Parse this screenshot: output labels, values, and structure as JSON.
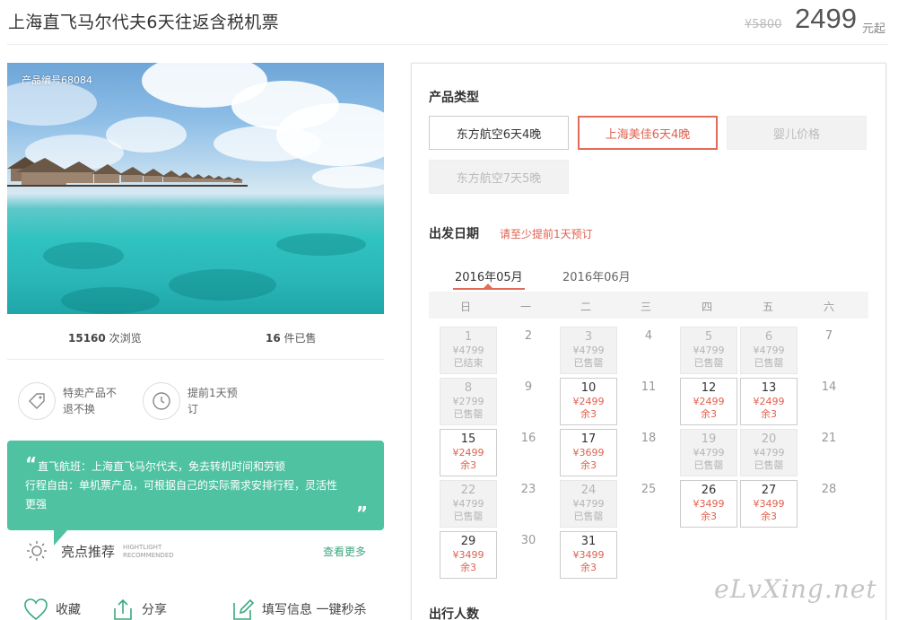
{
  "header": {
    "title": "上海直飞马尔代夫6天往返含税机票",
    "price_old": "¥5800",
    "price_now": "2499",
    "price_unit": "元起"
  },
  "hero": {
    "product_code": "产品编号68084"
  },
  "stats": {
    "views_count": "15160",
    "views_label": "次浏览",
    "sold_count": "16",
    "sold_label": "件已售"
  },
  "features": [
    {
      "icon": "tag-icon",
      "text": "特卖产品不退不换"
    },
    {
      "icon": "clock-icon",
      "text": "提前1天预订"
    }
  ],
  "notice": {
    "open_quote": "“",
    "close_quote": "”",
    "line1": "直飞航班：上海直飞马尔代夫，免去转机时间和劳顿",
    "line2": "行程自由：单机票产品，可根据自己的实际需求安排行程，灵活性",
    "line3": "更强"
  },
  "highlight": {
    "title": "亮点推荐",
    "en1": "HIGHTLIGHT",
    "en2": "RECOMMENDED",
    "more": "查看更多"
  },
  "actions": {
    "favorite": "收藏",
    "share": "分享",
    "fill": "填写信息 一键秒杀"
  },
  "product_type": {
    "title": "产品类型",
    "options": [
      {
        "label": "东方航空6天4晚",
        "state": "normal"
      },
      {
        "label": "上海美佳6天4晚",
        "state": "active"
      },
      {
        "label": "婴儿价格",
        "state": "disabled"
      },
      {
        "label": "东方航空7天5晚",
        "state": "disabled"
      }
    ]
  },
  "departure": {
    "title": "出发日期",
    "hint": "请至少提前1天预订",
    "months": [
      "2016年05月",
      "2016年06月"
    ],
    "weekdays": [
      "日",
      "一",
      "二",
      "三",
      "四",
      "五",
      "六"
    ],
    "days": [
      {
        "d": "1",
        "p": "¥4799",
        "s": "已结束",
        "st": "gray"
      },
      {
        "d": "2",
        "st": "plain"
      },
      {
        "d": "3",
        "p": "¥4799",
        "s": "已售罄",
        "st": "gray"
      },
      {
        "d": "4",
        "st": "plain"
      },
      {
        "d": "5",
        "p": "¥4799",
        "s": "已售罄",
        "st": "gray"
      },
      {
        "d": "6",
        "p": "¥4799",
        "s": "已售罄",
        "st": "gray"
      },
      {
        "d": "7",
        "st": "plain"
      },
      {
        "d": "8",
        "p": "¥2799",
        "s": "已售罄",
        "st": "gray"
      },
      {
        "d": "9",
        "st": "plain"
      },
      {
        "d": "10",
        "p": "¥2499",
        "s": "余3",
        "st": "avail"
      },
      {
        "d": "11",
        "st": "plain"
      },
      {
        "d": "12",
        "p": "¥2499",
        "s": "余3",
        "st": "avail"
      },
      {
        "d": "13",
        "p": "¥2499",
        "s": "余3",
        "st": "avail"
      },
      {
        "d": "14",
        "st": "plain"
      },
      {
        "d": "15",
        "p": "¥2499",
        "s": "余3",
        "st": "avail"
      },
      {
        "d": "16",
        "st": "plain"
      },
      {
        "d": "17",
        "p": "¥3699",
        "s": "余3",
        "st": "avail"
      },
      {
        "d": "18",
        "st": "plain"
      },
      {
        "d": "19",
        "p": "¥4799",
        "s": "已售罄",
        "st": "gray"
      },
      {
        "d": "20",
        "p": "¥4799",
        "s": "已售罄",
        "st": "gray"
      },
      {
        "d": "21",
        "st": "plain"
      },
      {
        "d": "22",
        "p": "¥4799",
        "s": "已售罄",
        "st": "gray"
      },
      {
        "d": "23",
        "st": "plain"
      },
      {
        "d": "24",
        "p": "¥4799",
        "s": "已售罄",
        "st": "gray"
      },
      {
        "d": "25",
        "st": "plain"
      },
      {
        "d": "26",
        "p": "¥3499",
        "s": "余3",
        "st": "avail"
      },
      {
        "d": "27",
        "p": "¥3499",
        "s": "余3",
        "st": "avail"
      },
      {
        "d": "28",
        "st": "plain"
      },
      {
        "d": "29",
        "p": "¥3499",
        "s": "余3",
        "st": "avail"
      },
      {
        "d": "30",
        "st": "plain"
      },
      {
        "d": "31",
        "p": "¥3499",
        "s": "余3",
        "st": "avail"
      }
    ]
  },
  "travelers": {
    "title": "出行人数"
  },
  "watermark": "eLvXing.net",
  "colors": {
    "accent": "#e26b5b",
    "green": "#4fc3a1"
  }
}
